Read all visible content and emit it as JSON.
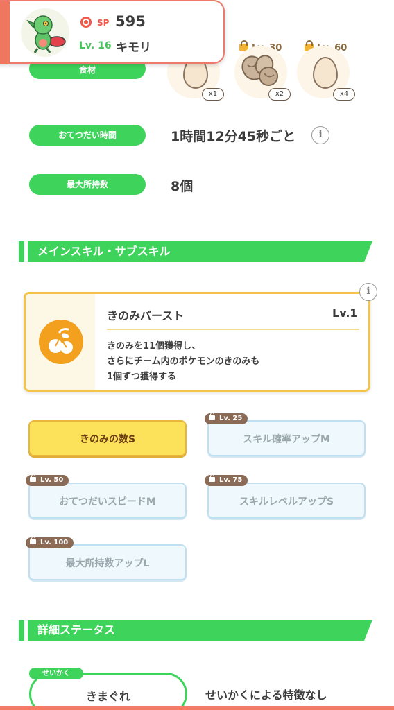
{
  "header": {
    "sp_label": "SP",
    "sp_value": "595",
    "level": "Lv. 16",
    "pokemon_name": "キモリ"
  },
  "ingredients": {
    "label": "食材",
    "items": [
      {
        "unlock": "",
        "count": "x1",
        "type": "egg"
      },
      {
        "unlock": "Lv. 30",
        "count": "x2",
        "type": "nuts"
      },
      {
        "unlock": "Lv. 60",
        "count": "x4",
        "type": "egg"
      }
    ]
  },
  "help_time": {
    "label": "おてつだい時間",
    "value": "1時間12分45秒ごと",
    "info_icon": "i"
  },
  "max_carry": {
    "label": "最大所持数",
    "value": "8個"
  },
  "skills_section": {
    "title": "メインスキル・サブスキル",
    "main_skill": {
      "info_icon": "i",
      "name": "きのみバースト",
      "level": "Lv.1",
      "desc_lines": [
        "きのみを11個獲得し、",
        "さらにチーム内のポケモンのきのみも",
        "1個ずつ獲得する"
      ]
    },
    "sub_skills": [
      {
        "label": "きのみの数S",
        "unlock": "",
        "state": "active"
      },
      {
        "label": "スキル確率アップM",
        "unlock": "Lv. 25",
        "state": "locked"
      },
      {
        "label": "おてつだいスピードM",
        "unlock": "Lv. 50",
        "state": "locked"
      },
      {
        "label": "スキルレベルアップS",
        "unlock": "Lv. 75",
        "state": "locked"
      },
      {
        "label": "最大所持数アップL",
        "unlock": "Lv. 100",
        "state": "locked"
      }
    ]
  },
  "details_section": {
    "title": "詳細ステータス",
    "nature_tag": "せいかく",
    "nature_value": "きまぐれ",
    "nature_effect": "せいかくによる特徴なし"
  },
  "colors": {
    "accent_green": "#3ed35a",
    "skill_orange": "#f3a01e",
    "header_red": "#f0775f",
    "active_yellow": "#fce15a",
    "locked_blue": "#eef8fd"
  }
}
